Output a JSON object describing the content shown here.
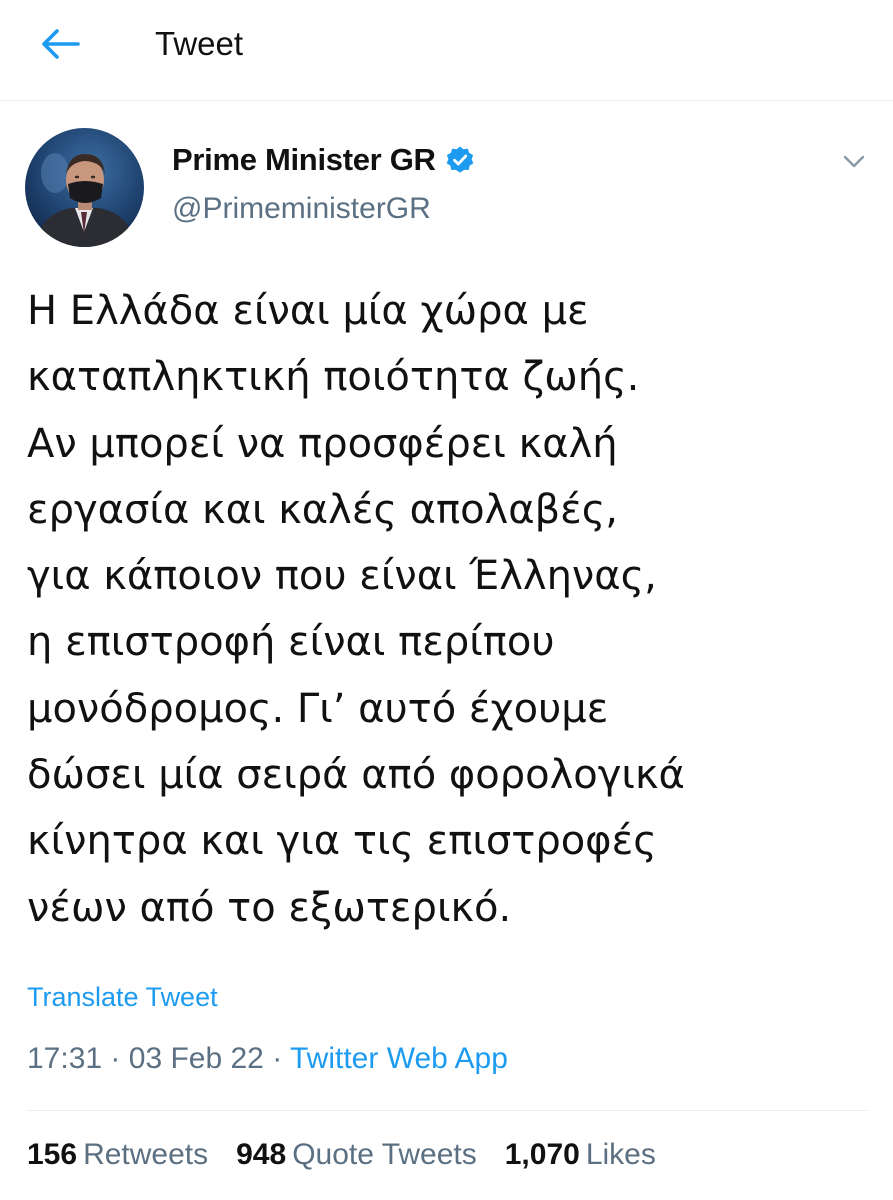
{
  "header": {
    "title": "Tweet",
    "back_icon": "arrow-left-icon",
    "accent_color": "#1d9bf0"
  },
  "author": {
    "name": "Prime Minister GR",
    "handle": "@PrimeministerGR",
    "verified": true,
    "verified_icon": "verified-badge-icon",
    "menu_icon": "chevron-down-icon"
  },
  "tweet": {
    "lines": [
      "Η Ελλάδα είναι μία χώρα με",
      "καταπληκτική ποιότητα ζωής.",
      "Αν μπορεί να προσφέρει καλή",
      "εργασία και καλές απολαβές,",
      "για κάποιον που είναι Έλληνας,",
      "η επιστροφή είναι περίπου",
      "μονόδρομος. Γι’ αυτό έχουμε",
      "δώσει μία σειρά από φορολογικά",
      "κίνητρα και για τις επιστροφές",
      "νέων από το εξωτερικό."
    ],
    "translate_label": "Translate Tweet",
    "time": "17:31",
    "separator": "·",
    "date": "03 Feb 22",
    "source": "Twitter Web App"
  },
  "stats": {
    "retweets_count": "156",
    "retweets_label": "Retweets",
    "quotes_count": "948",
    "quotes_label": "Quote Tweets",
    "likes_count": "1,070",
    "likes_label": "Likes"
  }
}
